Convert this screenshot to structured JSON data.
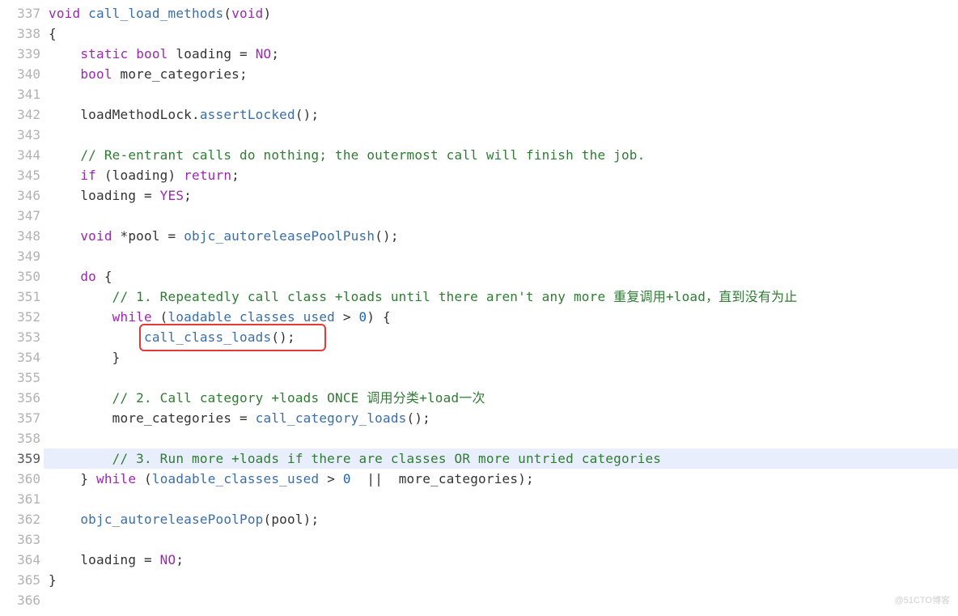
{
  "startLine": 337,
  "highlightLine": 359,
  "watermark": "@51CTO博客",
  "lines": [
    {
      "n": 337,
      "indent": 0,
      "tokens": [
        {
          "t": "void ",
          "c": "kw"
        },
        {
          "t": "call_load_methods",
          "c": "fname"
        },
        {
          "t": "(",
          "c": "op"
        },
        {
          "t": "void",
          "c": "kw"
        },
        {
          "t": ")",
          "c": "op"
        }
      ]
    },
    {
      "n": 338,
      "indent": 0,
      "tokens": [
        {
          "t": "{",
          "c": "op"
        }
      ]
    },
    {
      "n": 339,
      "indent": 1,
      "tokens": [
        {
          "t": "static ",
          "c": "kw"
        },
        {
          "t": "bool ",
          "c": "kw"
        },
        {
          "t": "loading = ",
          "c": "id"
        },
        {
          "t": "NO",
          "c": "const"
        },
        {
          "t": ";",
          "c": "op"
        }
      ]
    },
    {
      "n": 340,
      "indent": 1,
      "tokens": [
        {
          "t": "bool ",
          "c": "kw"
        },
        {
          "t": "more_categories;",
          "c": "id"
        }
      ]
    },
    {
      "n": 341,
      "indent": 0,
      "tokens": []
    },
    {
      "n": 342,
      "indent": 1,
      "tokens": [
        {
          "t": "loadMethodLock.",
          "c": "id"
        },
        {
          "t": "assertLocked",
          "c": "call"
        },
        {
          "t": "();",
          "c": "op"
        }
      ]
    },
    {
      "n": 343,
      "indent": 0,
      "tokens": []
    },
    {
      "n": 344,
      "indent": 1,
      "tokens": [
        {
          "t": "// Re-entrant calls do nothing; the outermost call will finish the job.",
          "c": "cmt"
        }
      ]
    },
    {
      "n": 345,
      "indent": 1,
      "tokens": [
        {
          "t": "if ",
          "c": "kw"
        },
        {
          "t": "(loading) ",
          "c": "id"
        },
        {
          "t": "return",
          "c": "kw"
        },
        {
          "t": ";",
          "c": "op"
        }
      ]
    },
    {
      "n": 346,
      "indent": 1,
      "tokens": [
        {
          "t": "loading = ",
          "c": "id"
        },
        {
          "t": "YES",
          "c": "const"
        },
        {
          "t": ";",
          "c": "op"
        }
      ]
    },
    {
      "n": 347,
      "indent": 0,
      "tokens": []
    },
    {
      "n": 348,
      "indent": 1,
      "tokens": [
        {
          "t": "void ",
          "c": "kw"
        },
        {
          "t": "*pool = ",
          "c": "id"
        },
        {
          "t": "objc_autoreleasePoolPush",
          "c": "call"
        },
        {
          "t": "();",
          "c": "op"
        }
      ]
    },
    {
      "n": 349,
      "indent": 0,
      "tokens": []
    },
    {
      "n": 350,
      "indent": 1,
      "tokens": [
        {
          "t": "do ",
          "c": "kw"
        },
        {
          "t": "{",
          "c": "op"
        }
      ]
    },
    {
      "n": 351,
      "indent": 2,
      "tokens": [
        {
          "t": "// 1. Repeatedly call class +loads until there aren't any more 重复调用+load，直到没有为止",
          "c": "cmt"
        }
      ]
    },
    {
      "n": 352,
      "indent": 2,
      "tokens": [
        {
          "t": "while ",
          "c": "kw"
        },
        {
          "t": "(",
          "c": "op"
        },
        {
          "t": "loadable_classes_used",
          "c": "call"
        },
        {
          "t": " > ",
          "c": "op"
        },
        {
          "t": "0",
          "c": "num"
        },
        {
          "t": ") {",
          "c": "op"
        }
      ]
    },
    {
      "n": 353,
      "indent": 3,
      "tokens": [
        {
          "t": "call_class_loads",
          "c": "call"
        },
        {
          "t": "();",
          "c": "op"
        }
      ]
    },
    {
      "n": 354,
      "indent": 2,
      "tokens": [
        {
          "t": "}",
          "c": "op"
        }
      ]
    },
    {
      "n": 355,
      "indent": 0,
      "tokens": []
    },
    {
      "n": 356,
      "indent": 2,
      "tokens": [
        {
          "t": "// 2. Call category +loads ONCE 调用分类+load一次",
          "c": "cmt"
        }
      ]
    },
    {
      "n": 357,
      "indent": 2,
      "tokens": [
        {
          "t": "more_categories = ",
          "c": "id"
        },
        {
          "t": "call_category_loads",
          "c": "call"
        },
        {
          "t": "();",
          "c": "op"
        }
      ]
    },
    {
      "n": 358,
      "indent": 0,
      "tokens": []
    },
    {
      "n": 359,
      "indent": 2,
      "tokens": [
        {
          "t": "// 3. Run more +loads if there are classes OR more untried categories",
          "c": "cmt"
        }
      ]
    },
    {
      "n": 360,
      "indent": 1,
      "tokens": [
        {
          "t": "} ",
          "c": "op"
        },
        {
          "t": "while ",
          "c": "kw"
        },
        {
          "t": "(",
          "c": "op"
        },
        {
          "t": "loadable_classes_used",
          "c": "call"
        },
        {
          "t": " > ",
          "c": "op"
        },
        {
          "t": "0",
          "c": "num"
        },
        {
          "t": "  ||  more_categories);",
          "c": "id"
        }
      ]
    },
    {
      "n": 361,
      "indent": 0,
      "tokens": []
    },
    {
      "n": 362,
      "indent": 1,
      "tokens": [
        {
          "t": "objc_autoreleasePoolPop",
          "c": "call"
        },
        {
          "t": "(pool);",
          "c": "id"
        }
      ]
    },
    {
      "n": 363,
      "indent": 0,
      "tokens": []
    },
    {
      "n": 364,
      "indent": 1,
      "tokens": [
        {
          "t": "loading = ",
          "c": "id"
        },
        {
          "t": "NO",
          "c": "const"
        },
        {
          "t": ";",
          "c": "op"
        }
      ]
    },
    {
      "n": 365,
      "indent": 0,
      "tokens": [
        {
          "t": "}",
          "c": "op"
        }
      ]
    },
    {
      "n": 366,
      "indent": 0,
      "tokens": []
    }
  ],
  "redBox": {
    "line": 353,
    "leftCh": 3,
    "widthCh": 22
  }
}
